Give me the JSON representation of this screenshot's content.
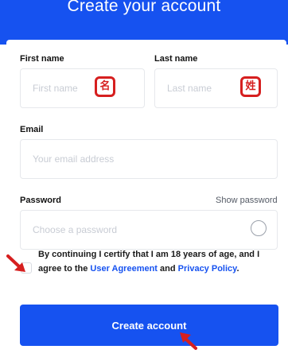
{
  "header": {
    "title": "Create your account"
  },
  "form": {
    "first_name": {
      "label": "First name",
      "placeholder": "First name",
      "annotation": "名"
    },
    "last_name": {
      "label": "Last name",
      "placeholder": "Last name",
      "annotation": "姓"
    },
    "email": {
      "label": "Email",
      "placeholder": "Your email address"
    },
    "password": {
      "label": "Password",
      "placeholder": "Choose a password",
      "show_label": "Show password"
    },
    "consent": {
      "text_before": "By continuing I certify that I am 18 years of age, and I agree to the ",
      "user_agreement": "User Agreement",
      "and": " and ",
      "privacy_policy": "Privacy Policy",
      "period": "."
    },
    "submit_label": "Create account"
  },
  "colors": {
    "brand": "#1652f0",
    "annotation_red": "#d61f1f"
  }
}
